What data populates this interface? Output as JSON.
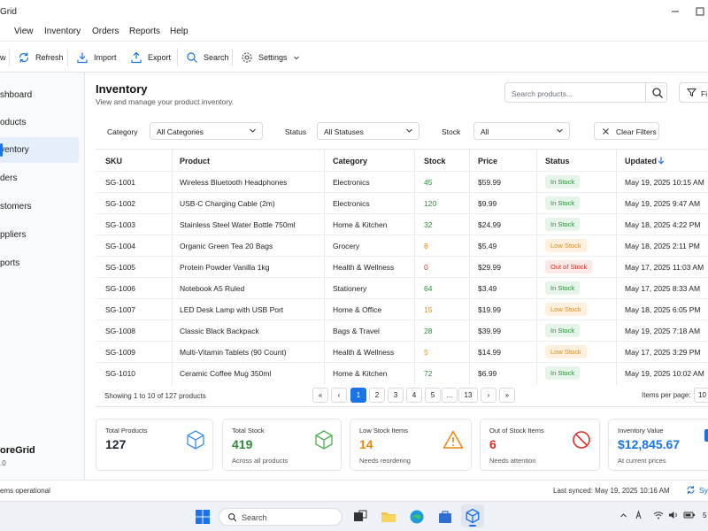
{
  "app": {
    "title": "Grid"
  },
  "menu": [
    "View",
    "Inventory",
    "Orders",
    "Reports",
    "Help"
  ],
  "toolbar": {
    "view_partial": "w",
    "refresh": "Refresh",
    "import": "Import",
    "export": "Export",
    "search": "Search",
    "settings": "Settings"
  },
  "sidebar": {
    "items": [
      "shboard",
      "oducts",
      "ventory",
      "ders",
      "stomers",
      "ppliers",
      "ports"
    ],
    "active_index": 2,
    "brand_name": "oreGrid",
    "brand_version": ".0"
  },
  "page": {
    "title": "Inventory",
    "subtitle": "View and manage your product inventory.",
    "search_placeholder": "Search products...",
    "filter_button_partial": "Fi"
  },
  "filters": {
    "category_label": "Category",
    "category_value": "All Categories",
    "status_label": "Status",
    "status_value": "All Statuses",
    "stock_label": "Stock",
    "stock_value": "All",
    "clear_label": "Clear Filters"
  },
  "table": {
    "headers": [
      "SKU",
      "Product",
      "Category",
      "Stock",
      "Price",
      "Status",
      "Updated"
    ],
    "rows": [
      {
        "sku": "SG-1001",
        "product": "Wireless Bluetooth Headphones",
        "category": "Electronics",
        "stock": "45",
        "price": "$59.99",
        "status": "In Stock",
        "updated": "May 19, 2025 10:15 AM"
      },
      {
        "sku": "SG-1002",
        "product": "USB-C Charging Cable (2m)",
        "category": "Electronics",
        "stock": "120",
        "price": "$9.99",
        "status": "In Stock",
        "updated": "May 19, 2025 9:47 AM"
      },
      {
        "sku": "SG-1003",
        "product": "Stainless Steel Water Bottle 750ml",
        "category": "Home & Kitchen",
        "stock": "32",
        "price": "$24.99",
        "status": "In Stock",
        "updated": "May 18, 2025 4:22 PM"
      },
      {
        "sku": "SG-1004",
        "product": "Organic Green Tea 20 Bags",
        "category": "Grocery",
        "stock": "8",
        "price": "$5.49",
        "status": "Low Stock",
        "updated": "May 18, 2025 2:11 PM"
      },
      {
        "sku": "SG-1005",
        "product": "Protein Powder Vanilla 1kg",
        "category": "Health & Wellness",
        "stock": "0",
        "price": "$29.99",
        "status": "Out of Stock",
        "updated": "May 17, 2025 11:03 AM"
      },
      {
        "sku": "SG-1006",
        "product": "Notebook A5 Ruled",
        "category": "Stationery",
        "stock": "64",
        "price": "$3.49",
        "status": "In Stock",
        "updated": "May 17, 2025 8:33 AM"
      },
      {
        "sku": "SG-1007",
        "product": "LED Desk Lamp with USB Port",
        "category": "Home & Office",
        "stock": "15",
        "price": "$19.99",
        "status": "Low Stock",
        "updated": "May 18, 2025 6:05 PM"
      },
      {
        "sku": "SG-1008",
        "product": "Classic Black Backpack",
        "category": "Bags & Travel",
        "stock": "28",
        "price": "$39.99",
        "status": "In Stock",
        "updated": "May 19, 2025 7:18 AM"
      },
      {
        "sku": "SG-1009",
        "product": "Multi-Vitamin Tablets (90 Count)",
        "category": "Health & Wellness",
        "stock": "5",
        "price": "$14.99",
        "status": "Low Stock",
        "updated": "May 17, 2025 3:29 PM"
      },
      {
        "sku": "SG-1010",
        "product": "Ceramic Coffee Mug 350ml",
        "category": "Home & Kitchen",
        "stock": "72",
        "price": "$6.99",
        "status": "In Stock",
        "updated": "May 19, 2025 10:02 AM"
      }
    ]
  },
  "pagination": {
    "summary": "Showing 1 to 10 of 127 products",
    "first": "«",
    "prev": "‹",
    "pages": [
      "1",
      "2",
      "3",
      "4",
      "5",
      "...",
      "13"
    ],
    "next": "›",
    "last": "»",
    "active_page": "1",
    "per_page_label": "Items per page:",
    "per_page_partial": "10"
  },
  "stats": [
    {
      "label": "Total Products",
      "value": "127",
      "note": "",
      "color": "#1f2430",
      "icon": "cube-icon"
    },
    {
      "label": "Total Stock",
      "value": "419",
      "note": "Across all products",
      "color": "#2e8b3a",
      "icon": "box-icon"
    },
    {
      "label": "Low Stock Items",
      "value": "14",
      "note": "Needs reordering",
      "color": "#e8870e",
      "icon": "warning-icon"
    },
    {
      "label": "Out of Stock Items",
      "value": "6",
      "note": "Needs attention",
      "color": "#d93025",
      "icon": "ban-icon"
    },
    {
      "label": "Inventory Value",
      "value": "$12,845.67",
      "note": "At current prices",
      "color": "#1a73e8",
      "icon": "dollar-icon"
    }
  ],
  "statusbar": {
    "left": "ems operational",
    "synced": "Last synced: May 19, 2025 10:16 AM",
    "sync_partial": "Sy"
  },
  "taskbar": {
    "search": "Search",
    "clock_partial": "5"
  },
  "colors": {
    "accent": "#1a73e8",
    "in_stock_text": "#2e8b3a",
    "in_stock_bg": "#e6f4ea",
    "low_text": "#e8870e",
    "low_bg": "#fdf0dc",
    "out_text": "#d93025",
    "out_bg": "#fce8e6"
  }
}
